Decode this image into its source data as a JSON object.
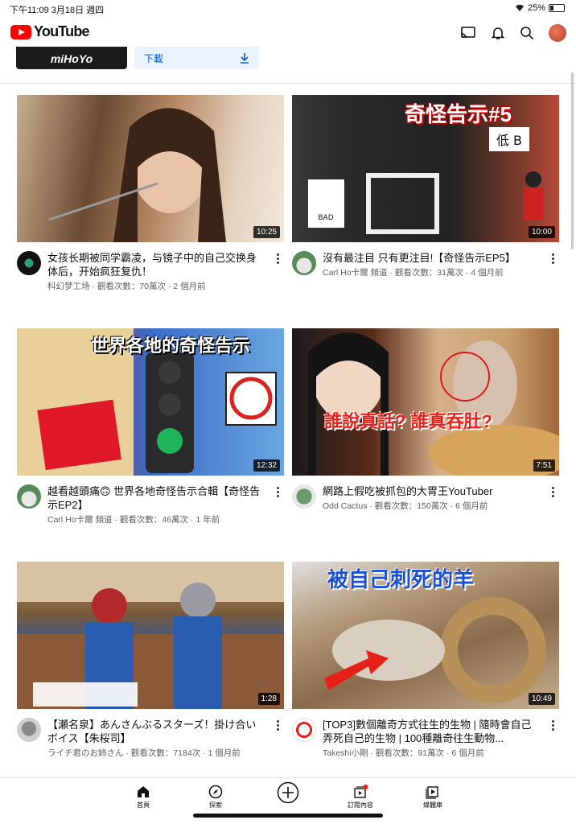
{
  "status": {
    "left": "下午11:09  3月18日 週四",
    "battery": "25%",
    "battery_level": 0.25
  },
  "header": {
    "brand": "YouTube"
  },
  "promo": {
    "thumb_text": "miHoYo",
    "download_label": "下載"
  },
  "videos": [
    {
      "title": "女孩长期被同学霸凌，与镜子中的自己交换身体后，开始疯狂复仇！",
      "subtitle": "科幻梦工场 · 觀看次數：70萬次 · 2 個月前",
      "duration": "10:25"
    },
    {
      "title": "沒有最注目 只有更注目!【奇怪告示EP5】",
      "subtitle": "Carl Ho卡爾 頻道 · 觀看次數：31萬次 · 4 個月前",
      "duration": "10:00",
      "overlay": "奇怪告示#5"
    },
    {
      "title": "越看越頭痛🙃 世界各地奇怪告示合輯【奇怪告示EP2】",
      "subtitle": "Carl Ho卡爾 頻道 · 觀看次數：46萬次 · 1 年前",
      "duration": "12:32",
      "overlay": "世界各地的奇怪告示"
    },
    {
      "title": "網路上假吃被抓包的大胃王YouTuber",
      "subtitle": "Odd Cactus · 觀看次數：150萬次 · 6 個月前",
      "duration": "7:51",
      "overlay": "誰說真話? 誰真吞肚?"
    },
    {
      "title": "【瀬名泉】あんさんぶるスターズ！掛け合いボイス【朱桜司】",
      "subtitle": "ライチ君のお姉さん · 觀看次數：7184次 · 1 個月前",
      "duration": "1:28"
    },
    {
      "title": "[TOP3]數個離奇方式往生的生物 | 隨時會自己弄死自己的生物 | 100種離奇往生動物...",
      "subtitle": "Takeshi小剛 · 觀看次數：91萬次 · 6 個月前",
      "duration": "10:49",
      "overlay": "被自己刺死的羊"
    }
  ],
  "nav": {
    "home": "首頁",
    "explore": "探索",
    "subscriptions": "訂閱內容",
    "library": "媒體庫"
  },
  "colors": {
    "brand": "#ff0000",
    "link": "#065fd4",
    "overlay_red": "#e8201a"
  }
}
